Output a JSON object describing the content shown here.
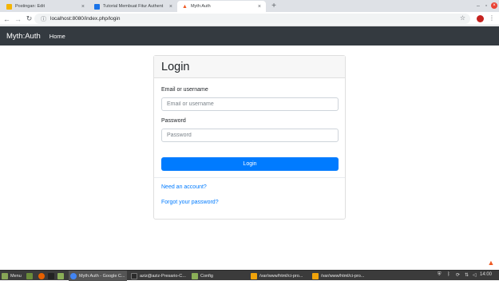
{
  "browser": {
    "tabs": [
      {
        "title": "Postingan: Edit",
        "active": false,
        "color": "#f4b400"
      },
      {
        "title": "Tutorial Membuat Fitur Authent",
        "active": false,
        "color": "#1a73e8"
      },
      {
        "title": "Myth:Auth",
        "active": true,
        "color": "#ef5b24"
      }
    ],
    "new_tab": "+",
    "close_glyph": "×",
    "url": "localhost:8080/index.php/login",
    "window_controls": {
      "minimize": "–",
      "maximize": "▫",
      "close": "×"
    }
  },
  "navbar": {
    "brand": "Myth:Auth",
    "home": "Home"
  },
  "login": {
    "title": "Login",
    "email_label": "Email or username",
    "email_placeholder": "Email or username",
    "password_label": "Password",
    "password_placeholder": "Password",
    "submit": "Login",
    "register_link": "Need an account?",
    "forgot_link": "Forgot your password?"
  },
  "taskbar": {
    "menu": "Menu",
    "windows": [
      {
        "title": "Myth:Auth - Google C...",
        "active": true
      },
      {
        "title": "aziz@aziz-Presario-C...",
        "active": false
      },
      {
        "title": "Config",
        "active": false
      },
      {
        "title": "/var/www/html/ci-pro...",
        "active": false
      },
      {
        "title": "/var/www/html/ci-pro...",
        "active": false
      }
    ],
    "clock": "14:00"
  },
  "colors": {
    "navbar": "#343a40",
    "primary": "#007bff",
    "taskbar": "#3b3b3b"
  }
}
